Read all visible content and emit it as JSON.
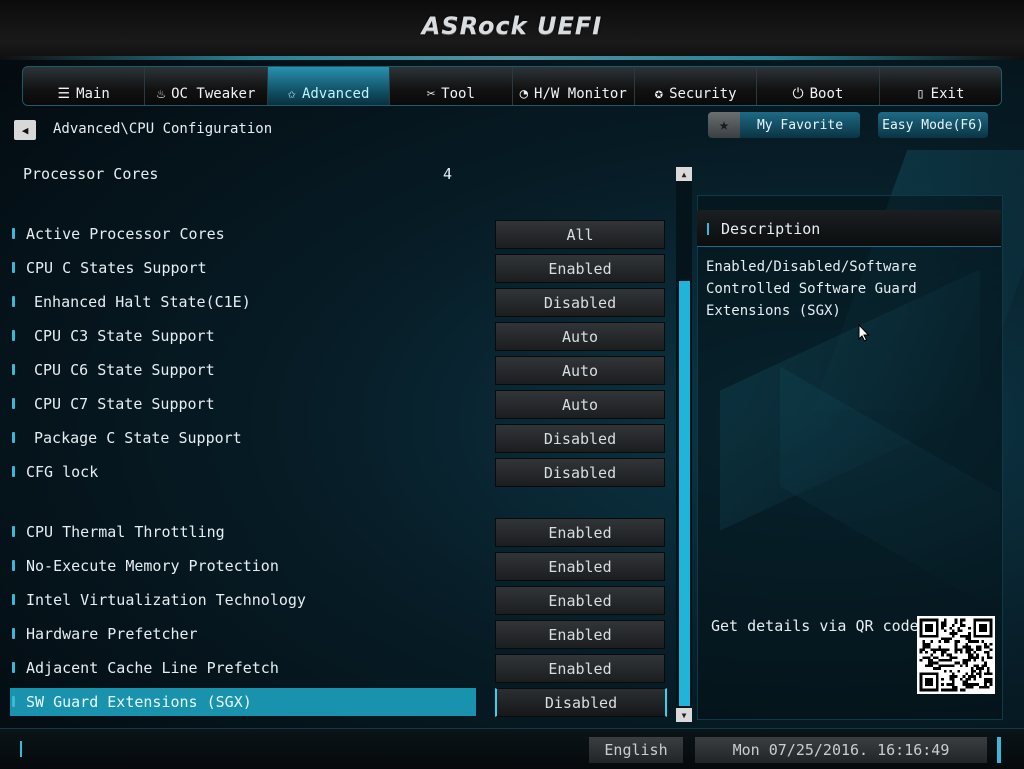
{
  "header": {
    "logo": "ASRock UEFI"
  },
  "tabs": [
    {
      "label": "Main",
      "icon": "menu-list-icon",
      "glyph": "☰",
      "active": false
    },
    {
      "label": "OC Tweaker",
      "icon": "flame-icon",
      "glyph": "♨",
      "active": false
    },
    {
      "label": "Advanced",
      "icon": "star-icon",
      "glyph": "✩",
      "active": true
    },
    {
      "label": "Tool",
      "icon": "tools-icon",
      "glyph": "✂",
      "active": false
    },
    {
      "label": "H/W Monitor",
      "icon": "monitor-icon",
      "glyph": "◔",
      "active": false
    },
    {
      "label": "Security",
      "icon": "shield-icon",
      "glyph": "✪",
      "active": false
    },
    {
      "label": "Boot",
      "icon": "power-icon",
      "glyph": "⏻",
      "active": false
    },
    {
      "label": "Exit",
      "icon": "exit-door-icon",
      "glyph": "▯",
      "active": false
    }
  ],
  "breadcrumb": "Advanced\\CPU Configuration",
  "favorite": {
    "label": "My Favorite",
    "icon": "star-icon"
  },
  "easy_mode": "Easy Mode(F6)",
  "processor_cores": {
    "label": "Processor Cores",
    "value": "4"
  },
  "settings": [
    {
      "label": "Active Processor Cores",
      "value": "All",
      "indent": false,
      "selected": false
    },
    {
      "label": "CPU C States Support",
      "value": "Enabled",
      "indent": false,
      "selected": false
    },
    {
      "label": "Enhanced Halt State(C1E)",
      "value": "Disabled",
      "indent": true,
      "selected": false
    },
    {
      "label": "CPU C3 State Support",
      "value": "Auto",
      "indent": true,
      "selected": false
    },
    {
      "label": "CPU C6 State Support",
      "value": "Auto",
      "indent": true,
      "selected": false
    },
    {
      "label": "CPU C7 State Support",
      "value": "Auto",
      "indent": true,
      "selected": false
    },
    {
      "label": "Package C State Support",
      "value": "Disabled",
      "indent": true,
      "selected": false
    },
    {
      "label": "CFG lock",
      "value": "Disabled",
      "indent": false,
      "selected": false
    },
    {
      "label": "CPU Thermal Throttling",
      "value": "Enabled",
      "indent": false,
      "selected": false
    },
    {
      "label": "No-Execute Memory Protection",
      "value": "Enabled",
      "indent": false,
      "selected": false
    },
    {
      "label": "Intel Virtualization Technology",
      "value": "Enabled",
      "indent": false,
      "selected": false
    },
    {
      "label": "Hardware Prefetcher",
      "value": "Enabled",
      "indent": false,
      "selected": false
    },
    {
      "label": "Adjacent Cache Line Prefetch",
      "value": "Enabled",
      "indent": false,
      "selected": false
    },
    {
      "label": "SW Guard Extensions (SGX)",
      "value": "Disabled",
      "indent": false,
      "selected": true
    }
  ],
  "description": {
    "title": "Description",
    "text": "Enabled/Disabled/Software\nControlled Software Guard\nExtensions (SGX)",
    "qr_label": "Get details via QR code"
  },
  "footer": {
    "language": "English",
    "datetime": "Mon 07/25/2016. 16:16:49"
  },
  "colors": {
    "accent": "#1fb4d8",
    "selected_row": "#1993ad"
  }
}
